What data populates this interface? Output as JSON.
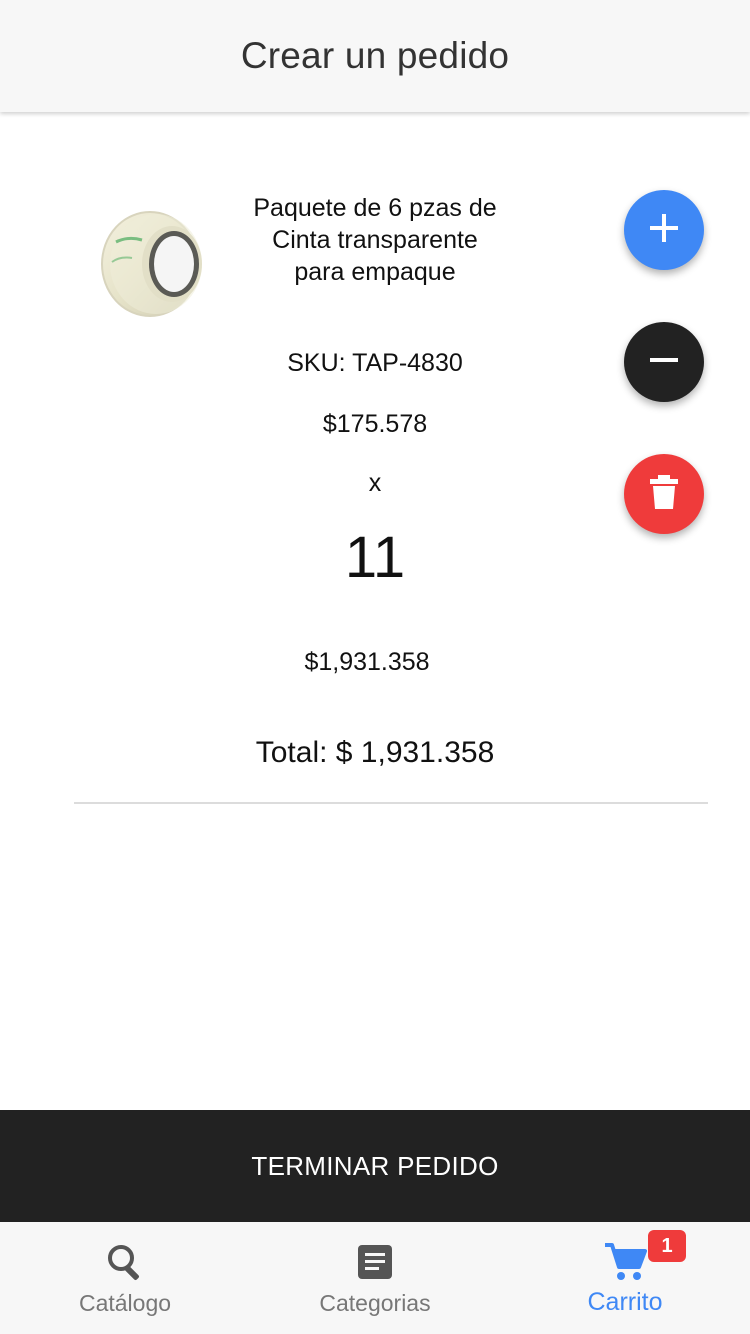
{
  "header": {
    "title": "Crear un pedido"
  },
  "item": {
    "name": "Paquete de 6 pzas de Cinta transparente para empaque",
    "sku": "SKU: TAP-4830",
    "price": "$175.578",
    "times": "x",
    "quantity": "11",
    "subtotal": "$1,931.358"
  },
  "total": "Total: $ 1,931.358",
  "actions": {
    "add_icon": "plus-icon",
    "remove_icon": "minus-icon",
    "delete_icon": "trash-icon"
  },
  "finish_button": "TERMINAR PEDIDO",
  "tabs": [
    {
      "label": "Catálogo",
      "icon": "search-icon"
    },
    {
      "label": "Categorias",
      "icon": "document-icon"
    },
    {
      "label": "Carrito",
      "icon": "cart-icon",
      "badge": "1",
      "active": true
    }
  ],
  "colors": {
    "accent": "#3f88f5",
    "dark": "#222222",
    "danger": "#ef3b3b"
  }
}
